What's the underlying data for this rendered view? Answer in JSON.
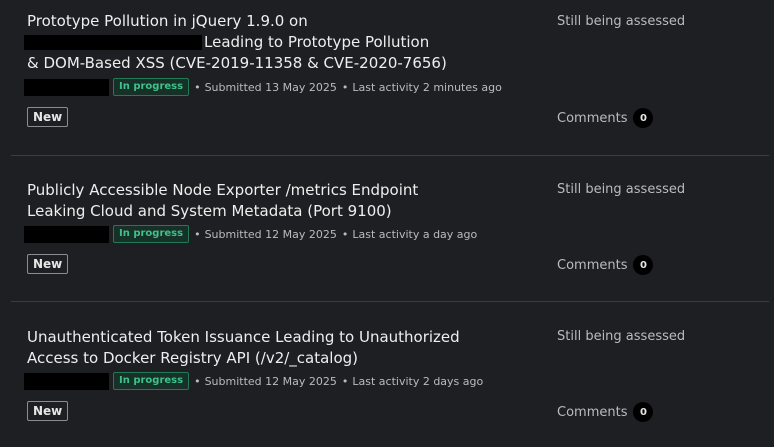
{
  "reports": [
    {
      "title_line1": "Prototype Pollution in jQuery 1.9.0 on",
      "title_line2_after_redaction": "Leading to Prototype Pollution",
      "title_line3": "& DOM-Based XSS (CVE-2019-11358 & CVE-2020-7656)",
      "status": "In progress",
      "submitted": "Submitted 13 May 2025",
      "last_activity": "Last activity 2 minutes ago",
      "state": "New",
      "assessment": "Still being assessed",
      "comments_label": "Comments",
      "comments_count": "0"
    },
    {
      "title_line1": "Publicly Accessible Node Exporter /metrics Endpoint",
      "title_line2": "Leaking Cloud and System Metadata (Port 9100)",
      "status": "In progress",
      "submitted": "Submitted 12 May 2025",
      "last_activity": "Last activity a day ago",
      "state": "New",
      "assessment": "Still being assessed",
      "comments_label": "Comments",
      "comments_count": "0"
    },
    {
      "title_line1": "Unauthenticated Token Issuance Leading to Unauthorized",
      "title_line2": "Access to Docker Registry API (/v2/_catalog)",
      "status": "In progress",
      "submitted": "Submitted 12 May 2025",
      "last_activity": "Last activity 2 days ago",
      "state": "New",
      "assessment": "Still being assessed",
      "comments_label": "Comments",
      "comments_count": "0"
    }
  ],
  "separator": "•",
  "colors": {
    "background": "#1e1f22",
    "status_green": "#3ec18a",
    "divider": "#3a3c40"
  }
}
